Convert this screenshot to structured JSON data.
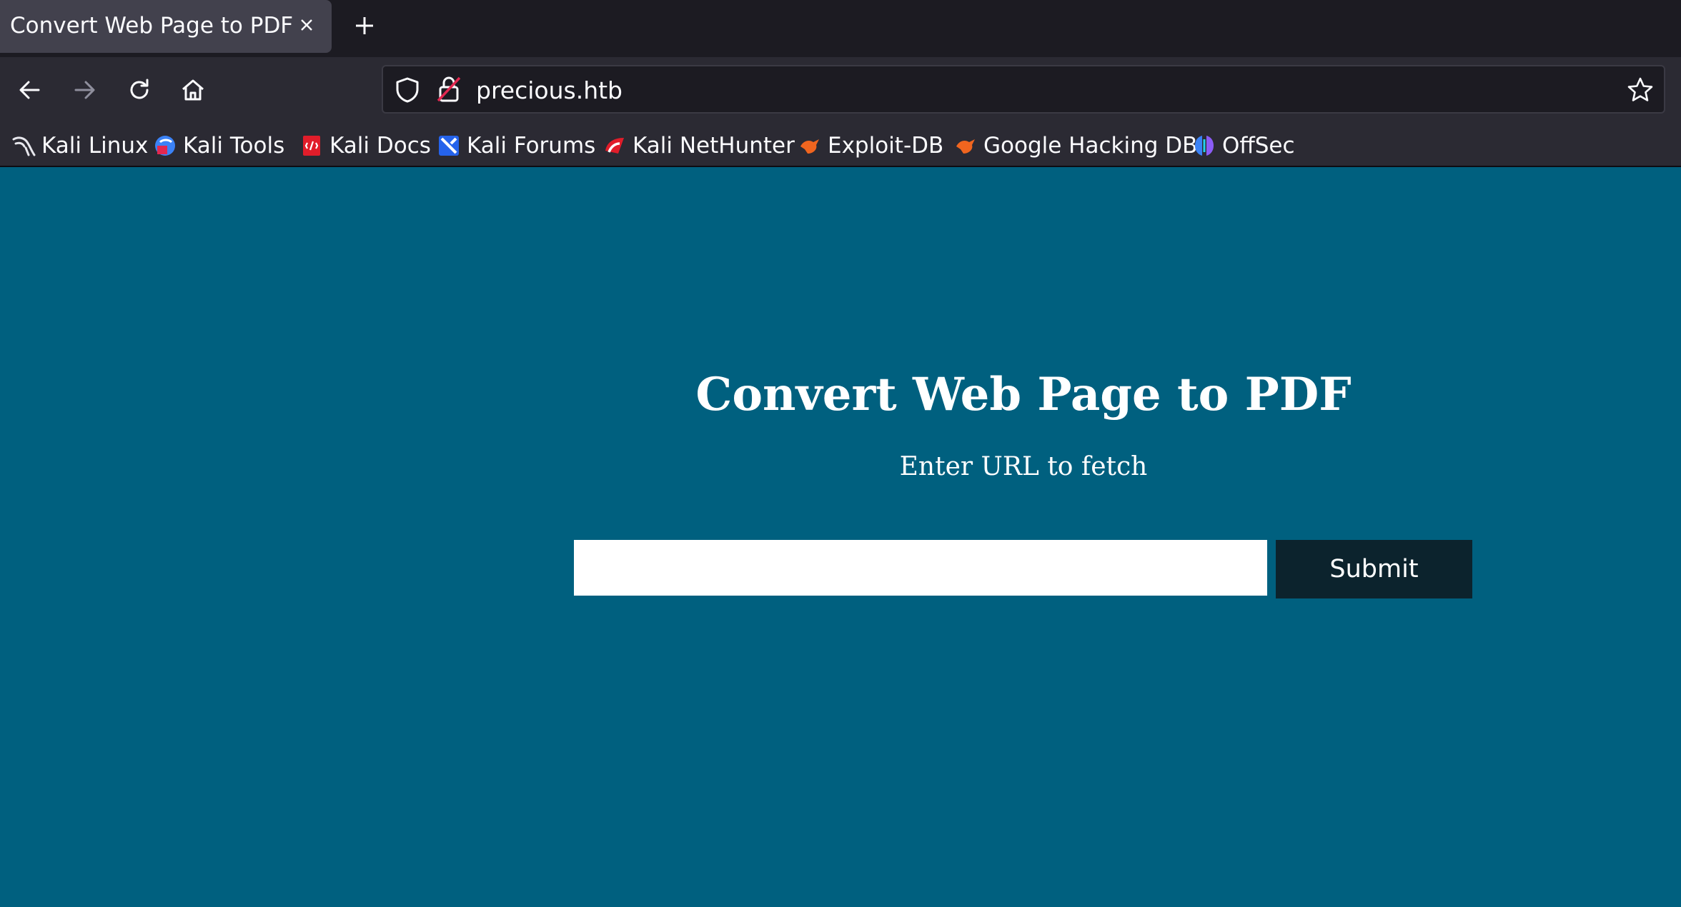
{
  "browser": {
    "tab": {
      "title": "Convert Web Page to PDF"
    },
    "address": {
      "url": "precious.htb"
    },
    "bookmarks": [
      {
        "label": "Kali Linux",
        "icon": "kali-dragon-icon"
      },
      {
        "label": "Kali Tools",
        "icon": "kali-tools-icon"
      },
      {
        "label": "Kali Docs",
        "icon": "kali-docs-icon"
      },
      {
        "label": "Kali Forums",
        "icon": "kali-forums-icon"
      },
      {
        "label": "Kali NetHunter",
        "icon": "kali-nethunter-icon"
      },
      {
        "label": "Exploit-DB",
        "icon": "exploit-db-icon"
      },
      {
        "label": "Google Hacking DB",
        "icon": "ghdb-icon"
      },
      {
        "label": "OffSec",
        "icon": "offsec-icon"
      }
    ]
  },
  "page": {
    "heading": "Convert Web Page to PDF",
    "subheading": "Enter URL to fetch",
    "url_input": {
      "value": "",
      "placeholder": ""
    },
    "submit_label": "Submit"
  },
  "colors": {
    "page_background": "#00607f",
    "submit_background": "#0c232d",
    "toolbar_background": "#2b2a33",
    "tabstrip_background": "#1c1b22"
  }
}
